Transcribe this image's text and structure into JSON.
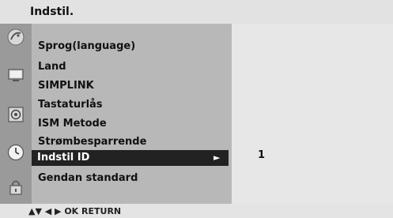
{
  "header": {
    "title": "Indstil."
  },
  "sidebar_icons": [
    {
      "icon": "satellite-dish-icon"
    },
    {
      "icon": "tv-screen-icon"
    },
    {
      "icon": "speaker-icon"
    },
    {
      "icon": "clock-icon"
    },
    {
      "icon": "lock-icon"
    }
  ],
  "menu": {
    "items": [
      {
        "label": "Sprog(language)"
      },
      {
        "label": "Land"
      },
      {
        "label": "SIMPLINK"
      },
      {
        "label": "Tastaturlås"
      },
      {
        "label": "ISM Metode"
      },
      {
        "label": "Strømbesparrende"
      },
      {
        "label": "Indstil ID",
        "selected": true,
        "arrow": "►"
      },
      {
        "label": "Gendan standard"
      }
    ]
  },
  "value_panel": {
    "value": "1"
  },
  "footer": {
    "nav_hint": "▲▼  ◀ ▶  OK  RETURN"
  },
  "colors": {
    "header_bg": "#e2e2e2",
    "icon_bar_bg": "#9a9a9a",
    "menu_bg": "#b8b8b8",
    "value_bg": "#e7e7e7",
    "selected_bg": "#222222",
    "selected_text": "#ffffff"
  }
}
